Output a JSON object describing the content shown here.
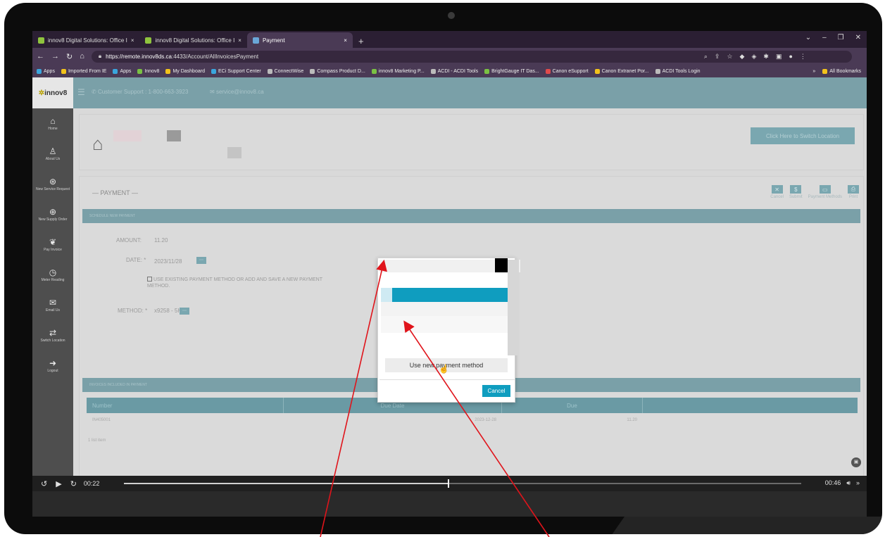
{
  "browser": {
    "tabs": [
      {
        "label": "innov8 Digital Solutions: Office I",
        "close": "×"
      },
      {
        "label": "innov8 Digital Solutions: Office I",
        "close": "×"
      },
      {
        "label": "Payment",
        "close": "×"
      }
    ],
    "new_tab": "+",
    "url_host": "https://remote.innov8ds.ca",
    "url_path": ":4433/Account/AllInvoicesPayment",
    "bookmarks": [
      "Apps",
      "Imported From IE",
      "Apps",
      "Innov8",
      "My Dashboard",
      "ECi Support Center",
      "ConnectWise",
      "Compass Product D...",
      "innov8 Marketing P...",
      "ACDI - ACDI Tools",
      "BrightGauge IT Das...",
      "Canon eSupport",
      "Canon Extranet Por...",
      "ACDI Tools Login"
    ],
    "bookmarks_more": "»",
    "all_bookmarks": "All Bookmarks"
  },
  "site": {
    "logo": "innov8",
    "support": "Customer Support : 1-800-663-3923",
    "email": "service@innov8.ca",
    "switch_location": "Click Here to Switch Location"
  },
  "sidebar": {
    "items": [
      {
        "label": "Home",
        "icon": "home-icon",
        "glyph": "⌂"
      },
      {
        "label": "About Us",
        "icon": "user-icon",
        "glyph": "♙"
      },
      {
        "label": "New Service Request",
        "icon": "service-icon",
        "glyph": "⊛"
      },
      {
        "label": "New Supply Order",
        "icon": "supply-icon",
        "glyph": "⊕"
      },
      {
        "label": "Pay Invoice",
        "icon": "handshake-icon",
        "glyph": "❦"
      },
      {
        "label": "Meter Reading",
        "icon": "meter-icon",
        "glyph": "◷"
      },
      {
        "label": "Email Us",
        "icon": "mail-icon",
        "glyph": "✉"
      },
      {
        "label": "Switch Location",
        "icon": "switch-icon",
        "glyph": "⇄"
      },
      {
        "label": "Logout",
        "icon": "logout-icon",
        "glyph": "➜"
      }
    ]
  },
  "payment": {
    "title": "— PAYMENT —",
    "actions": [
      {
        "label": "Cancel",
        "glyph": "✕"
      },
      {
        "label": "Submit",
        "glyph": "$"
      },
      {
        "label": "Payment Methods",
        "glyph": "▭"
      },
      {
        "label": "Print",
        "glyph": "⎙"
      }
    ],
    "schedule_header": "SCHEDULE NEW PAYMENT",
    "amount_label": "AMOUNT:",
    "amount_value": "11.20",
    "date_label": "DATE: *",
    "date_value": "2023/11/28",
    "checkbox_text": "USE EXISTING PAYMENT METHOD OR ADD AND SAVE A NEW PAYMENT METHOD.",
    "method_label": "METHOD: *",
    "method_value": "x9258 - 5H",
    "invoices_header": "INVOICES INCLUDED IN PAYMENT",
    "columns": [
      "Number",
      "Due Date",
      "Due"
    ],
    "rows": [
      {
        "number": "IN405001",
        "due_date": "2023-12-28",
        "due": "11.20"
      }
    ],
    "count": "1 list item"
  },
  "modal": {
    "new_payment": "Use new payment method",
    "cancel": "Cancel"
  },
  "player": {
    "current": "00:22",
    "total": "00:46",
    "progress": 0.478
  }
}
